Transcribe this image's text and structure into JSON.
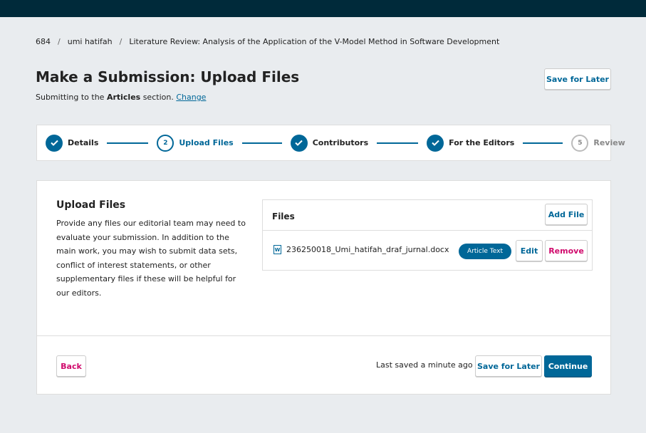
{
  "breadcrumb": {
    "items": [
      "684",
      "umi hatifah",
      "Literature Review: Analysis of the Application of the V-Model Method in Software Development"
    ],
    "separator": "/"
  },
  "header": {
    "title": "Make a Submission: Upload Files",
    "subtitle_prefix": "Submitting to the",
    "section_name": "Articles",
    "subtitle_suffix": "section.",
    "change_link": "Change",
    "save_later": "Save for Later"
  },
  "steps": [
    {
      "label": "Details",
      "state": "done",
      "number": "1",
      "icon": "check-icon"
    },
    {
      "label": "Upload Files",
      "state": "current",
      "number": "2"
    },
    {
      "label": "Contributors",
      "state": "done",
      "number": "3",
      "icon": "check-icon"
    },
    {
      "label": "For the Editors",
      "state": "done",
      "number": "4",
      "icon": "check-icon"
    },
    {
      "label": "Review",
      "state": "pending",
      "number": "5"
    }
  ],
  "upload": {
    "title": "Upload Files",
    "description": "Provide any files our editorial team may need to evaluate your submission. In addition to the main work, you may wish to submit data sets, conflict of interest statements, or other supplementary files if these will be helpful for our editors."
  },
  "files": {
    "title": "Files",
    "add_file": "Add File",
    "items": [
      {
        "icon": "word-document-icon",
        "icon_glyph": "W",
        "name": "236250018_Umi_hatifah_draf_jurnal.docx",
        "genre": "Article Text",
        "edit": "Edit",
        "remove": "Remove"
      }
    ]
  },
  "footer": {
    "back": "Back",
    "last_saved": "Last saved a minute ago",
    "save_later": "Save for Later",
    "continue": "Continue"
  },
  "colors": {
    "primary": "#006798",
    "danger": "#d00a6c",
    "topbar": "#002a3a",
    "background": "#e9ecef"
  }
}
